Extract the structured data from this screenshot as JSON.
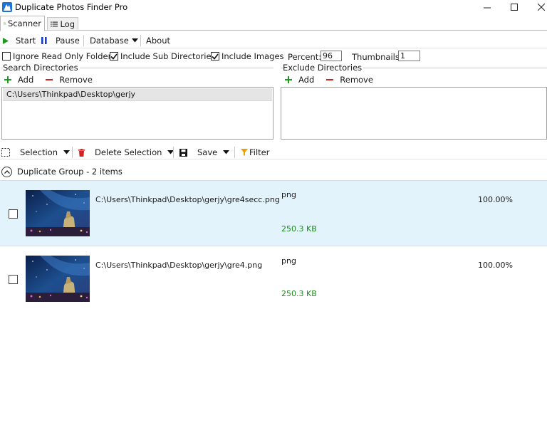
{
  "window": {
    "title": "Duplicate Photos Finder Pro"
  },
  "tabs": [
    {
      "label": "Scanner",
      "icon": "scan-icon",
      "active": true
    },
    {
      "label": "Log",
      "icon": "list-icon",
      "active": false
    }
  ],
  "toolbar": {
    "start_label": "Start",
    "pause_label": "Pause",
    "database_label": "Database",
    "about_label": "About"
  },
  "options": {
    "ignore_read_only": {
      "label": "Ignore Read Only Folders",
      "checked": false
    },
    "include_sub_dirs": {
      "label": "Include Sub Directories",
      "checked": true
    },
    "include_images": {
      "label": "Include Images",
      "checked": true
    },
    "percent_label": "Percent:",
    "percent_value": "96",
    "thumbnails_label": "Thumbnails",
    "thumbnails_value": "1"
  },
  "search_dirs": {
    "title": "Search Directories",
    "add_label": "Add",
    "remove_label": "Remove",
    "items": [
      "C:\\Users\\Thinkpad\\Desktop\\gerjy"
    ]
  },
  "exclude_dirs": {
    "title": "Exclude Directories",
    "add_label": "Add",
    "remove_label": "Remove",
    "items": []
  },
  "results_toolbar": {
    "selection_label": "Selection",
    "delete_selection_label": "Delete Selection",
    "save_label": "Save",
    "filter_label": "Filter"
  },
  "group": {
    "label": "Duplicate Group - 2 items",
    "items": [
      {
        "path": "C:\\Users\\Thinkpad\\Desktop\\gerjy\\gre4secc.png",
        "type": "png",
        "size": "250.3 KB",
        "similarity": "100.00%",
        "selected": false,
        "highlighted": true
      },
      {
        "path": "C:\\Users\\Thinkpad\\Desktop\\gerjy\\gre4.png",
        "type": "png",
        "size": "250.3 KB",
        "similarity": "100.00%",
        "selected": false,
        "highlighted": false
      }
    ]
  },
  "colors": {
    "accent": "#1e73d8",
    "start_green": "#1e9b1e",
    "pause_blue": "#1a3fcc",
    "remove_red": "#d42020",
    "size_green": "#1e8a1e",
    "highlight_row": "#e3f3fb",
    "filter_yellow": "#e8a300"
  }
}
